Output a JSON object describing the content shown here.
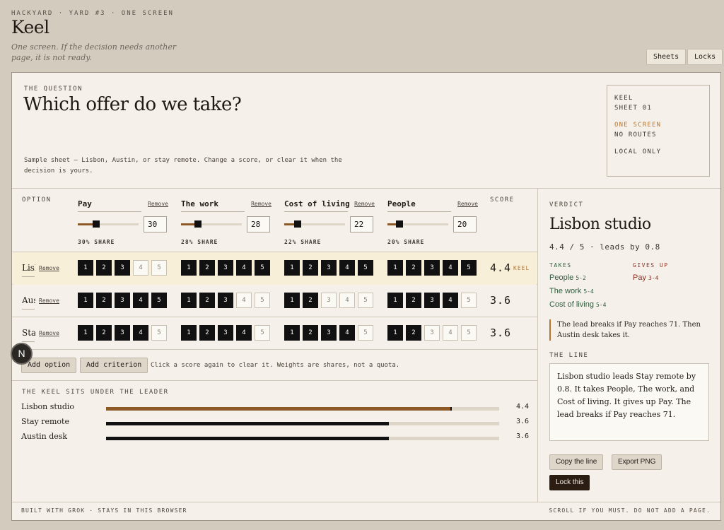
{
  "header": {
    "eyebrow": "HACKYARD · YARD #3 · ONE SCREEN",
    "title": "Keel",
    "tagline": "One screen. If the decision needs another page, it is not ready.",
    "sheets_label": "Sheets",
    "locks_label": "Locks"
  },
  "question": {
    "eyebrow": "THE QUESTION",
    "title": "Which offer do we take?",
    "description": "Sample sheet — Lisbon, Austin, or stay remote. Change a score, or clear it when the decision is yours."
  },
  "meta": {
    "line1": "KEEL",
    "line2": "SHEET 01",
    "line3": "ONE SCREEN",
    "line4": "NO ROUTES",
    "line5": "LOCAL ONLY"
  },
  "table": {
    "option_header": "OPTION",
    "score_header": "SCORE",
    "remove_label": "Remove",
    "criteria": [
      {
        "name": "Pay",
        "weight": "30",
        "share": "30% SHARE",
        "fraction": 0.3
      },
      {
        "name": "The work",
        "weight": "28",
        "share": "28% SHARE",
        "fraction": 0.28
      },
      {
        "name": "Cost of living",
        "weight": "22",
        "share": "22% SHARE",
        "fraction": 0.22
      },
      {
        "name": "People",
        "weight": "20",
        "share": "20% SHARE",
        "fraction": 0.2
      }
    ],
    "rows": [
      {
        "name": "Lisbon studio",
        "scores": [
          3,
          5,
          5,
          5
        ],
        "total": "4.4",
        "tag": "KEEL",
        "lead": true
      },
      {
        "name": "Austin desk",
        "scores": [
          5,
          3,
          2,
          4
        ],
        "total": "3.6",
        "tag": "",
        "lead": false
      },
      {
        "name": "Stay remote",
        "scores": [
          4,
          4,
          4,
          2
        ],
        "total": "3.6",
        "tag": "",
        "lead": false
      }
    ]
  },
  "toolbar": {
    "add_option": "Add option",
    "add_criterion": "Add criterion",
    "hint": "Click a score again to clear it. Weights are shares, not a quota.",
    "avatar_letter": "N"
  },
  "bars": {
    "eyebrow": "THE KEEL SITS UNDER THE LEADER",
    "max": 5,
    "items": [
      {
        "label": "Lisbon studio",
        "value": 4.4,
        "display": "4.4",
        "lead": true
      },
      {
        "label": "Stay remote",
        "value": 3.6,
        "display": "3.6",
        "lead": false
      },
      {
        "label": "Austin desk",
        "value": 3.6,
        "display": "3.6",
        "lead": false
      }
    ]
  },
  "verdict": {
    "eyebrow": "VERDICT",
    "title": "Lisbon studio",
    "meta": "4.4 / 5 · leads by 0.8",
    "takes_header": "TAKES",
    "gives_header": "GIVES UP",
    "takes": [
      {
        "label": "People",
        "pts": "5-2"
      },
      {
        "label": "The work",
        "pts": "5-4"
      },
      {
        "label": "Cost of living",
        "pts": "5-4"
      }
    ],
    "gives": [
      {
        "label": "Pay",
        "pts": "3-4"
      }
    ],
    "callout": "The lead breaks if Pay reaches 71. Then Austin desk takes it.",
    "line_eyebrow": "THE LINE",
    "line_text": "Lisbon studio leads Stay remote by 0.8. It takes People, The work, and Cost of living. It gives up Pay. The lead breaks if Pay reaches 71.",
    "copy_label": "Copy the line",
    "export_label": "Export PNG",
    "lock_label": "Lock this"
  },
  "footer": {
    "left": "BUILT WITH GROK · STAYS IN THIS BROWSER",
    "right": "SCROLL IF YOU MUST. DO NOT ADD A PAGE."
  }
}
